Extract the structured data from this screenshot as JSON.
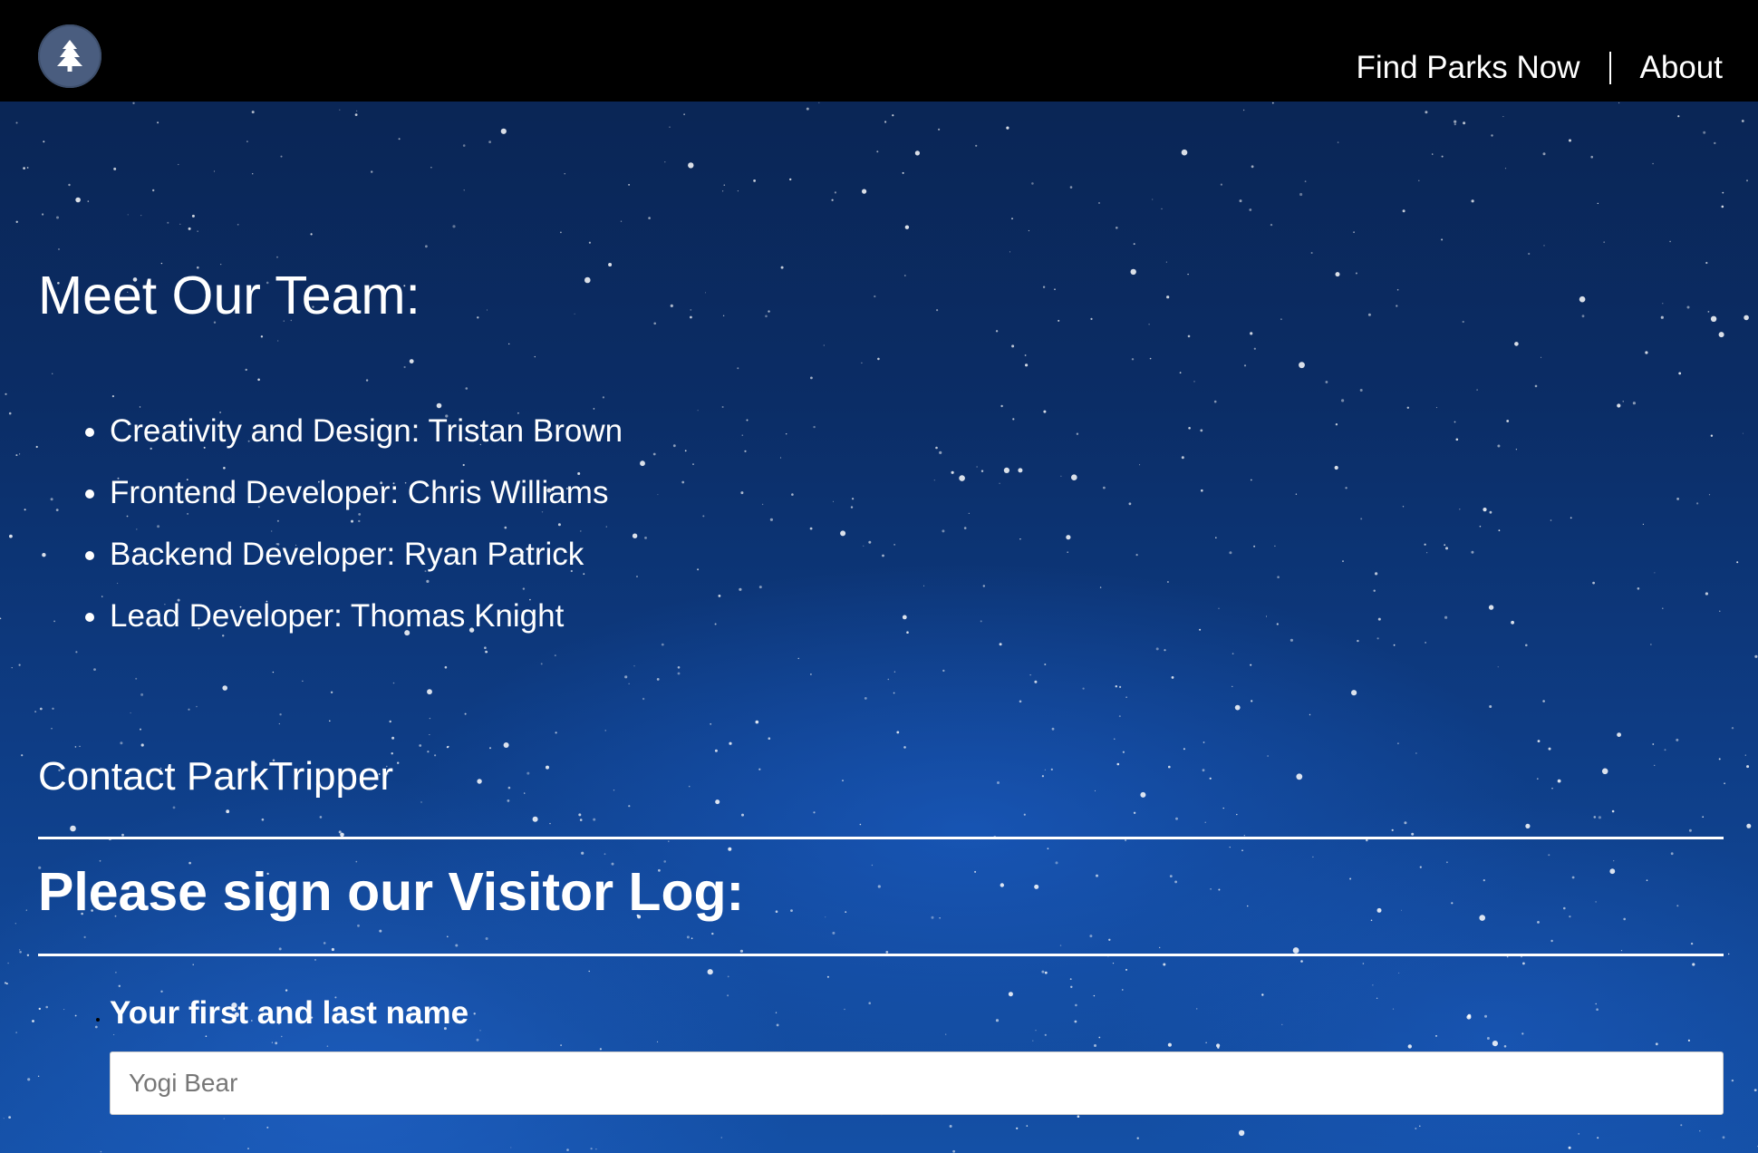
{
  "nav": {
    "logo_icon": "pine-tree-icon",
    "links": [
      "Find Parks Now",
      "About"
    ]
  },
  "team": {
    "title": "Meet Our Team:",
    "members": [
      "Creativity and Design: Tristan Brown",
      "Frontend Developer: Chris Williams",
      "Backend Developer: Ryan Patrick",
      "Lead Developer: Thomas Knight"
    ]
  },
  "contact": {
    "title": "Contact ParkTripper"
  },
  "visitor_log": {
    "title": "Please sign our Visitor Log:",
    "name_label": "Your first and last name",
    "name_placeholder": "Yogi Bear"
  },
  "colors": {
    "topbar": "#000000",
    "logo_bg": "#4a5d7f",
    "text": "#ffffff",
    "sky_dark": "#0a2350",
    "sky_light": "#1450a6"
  }
}
